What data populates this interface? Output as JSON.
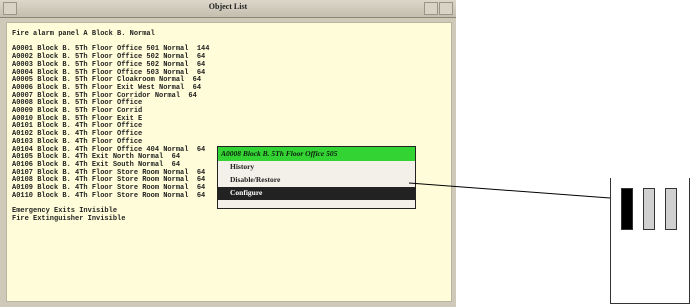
{
  "window": {
    "title": "Object List"
  },
  "list": {
    "header": "Fire alarm panel A Block B. Normal",
    "rows": [
      "A0001 Block B. 5Th Floor Office 501 Normal  144",
      "A0002 Block B. 5Th Floor Office 502 Normal  64",
      "A0003 Block B. 5Th Floor Office 502 Normal  64",
      "A0004 Block B. 5Th Floor Office 503 Normal  64",
      "A0005 Block B. 5Th Floor Cloakroom Normal  64",
      "A0006 Block B. 5Th Floor Exit West Normal  64",
      "A0007 Block B. 5Th Floor Corridor Normal  64",
      "A0008 Block B. 5Th Floor Office",
      "A0009 Block B. 5Th Floor Corrid",
      "A0010 Block B. 5Th Floor Exit E",
      "A0101 Block B. 4Th Floor Office",
      "A0102 Block B. 4Th Floor Office",
      "A0103 Block B. 4Th Floor Office",
      "A0104 Block B. 4Th Floor Office 404 Normal  64",
      "A0105 Block B. 4Th Exit North Normal  64",
      "A0106 Block B. 4Th Exit South Normal  64",
      "A0107 Block B. 4Th Floor Store Room Normal  64",
      "A0108 Block B. 4Th Floor Store Room Normal  64",
      "A0109 Block B. 4Th Floor Store Room Normal  64",
      "A0110 Block B. 4Th Floor Store Room Normal  64"
    ],
    "footer1": "Emergency Exits Invisible",
    "footer2": "Fire Extinguisher Invisible"
  },
  "context_menu": {
    "header": "A0008 Block B. 5Th Floor Office 505",
    "items": [
      "History",
      "Disable/Restore",
      "Configure"
    ]
  },
  "colors": {
    "menu_header": "#34d334",
    "pane_bg": "#fffdd9",
    "window_bg": "#cfc9ba",
    "active_item": "#222222"
  }
}
